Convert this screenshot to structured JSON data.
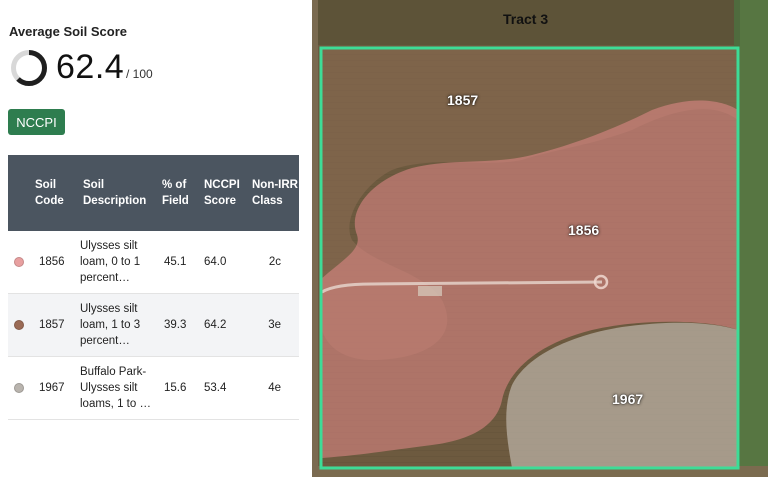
{
  "summary": {
    "title": "Average Soil Score",
    "score": "62.4",
    "score_max": "/ 100",
    "score_fraction": 0.624,
    "ring_color": "#1f1f1f",
    "ring_track_color": "#d8d8d8"
  },
  "toggle": {
    "label": "NCCPI",
    "color": "#2e7d4f"
  },
  "table": {
    "headers": {
      "code": "Soil Code",
      "description": "Soil Description",
      "pct": "% of Field",
      "score": "NCCPI Score",
      "cls": "Non-IRR Class"
    },
    "rows": [
      {
        "color": "#e8a0a0",
        "code": "1856",
        "description": "Ulysses silt loam, 0 to 1 percent…",
        "pct": "45.1",
        "score": "64.0",
        "cls": "2c"
      },
      {
        "color": "#9a6a55",
        "code": "1857",
        "description": "Ulysses silt loam, 1 to 3 percent…",
        "pct": "39.3",
        "score": "64.2",
        "cls": "3e"
      },
      {
        "color": "#b9b4ae",
        "code": "1967",
        "description": "Buffalo Park-Ulysses silt loams, 1 to …",
        "pct": "15.6",
        "score": "53.4",
        "cls": "4e"
      }
    ]
  },
  "map": {
    "tract_label": "Tract 3",
    "boundary_color": "#3ddc97",
    "zones": [
      {
        "code": "1857",
        "color": "#8a6a52"
      },
      {
        "code": "1856",
        "color": "#e48a8a"
      },
      {
        "code": "1967",
        "color": "#c4bdb2"
      }
    ]
  }
}
